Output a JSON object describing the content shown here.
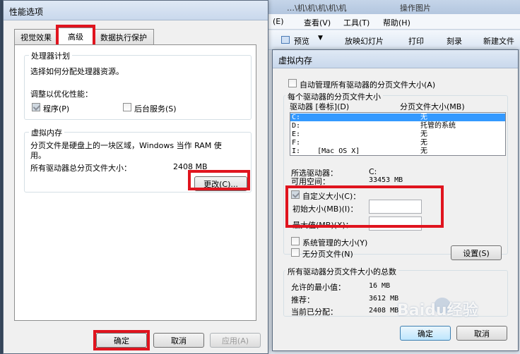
{
  "bg_window": {
    "menu": [
      "(E)",
      "查看(V)",
      "工具(T)",
      "帮助(H)"
    ],
    "breadcrumb_fragment": "…\\机\\机\\机\\机\\机",
    "breadcrumb_tail": "操作图片",
    "toolbar": [
      "预览",
      "放映幻灯片",
      "打印",
      "刻录",
      "新建文件"
    ]
  },
  "perf": {
    "title": "性能选项",
    "tabs": [
      "视觉效果",
      "高级",
      "数据执行保护"
    ],
    "processor": {
      "legend": "处理器计划",
      "desc": "选择如何分配处理器资源。",
      "adjust": "调整以优化性能：",
      "programs": "程序(P)",
      "services": "后台服务(S)"
    },
    "vm": {
      "legend": "虚拟内存",
      "desc1": "分页文件是硬盘上的一块区域，Windows 当作 RAM 使",
      "desc2": "用。",
      "total_label": "所有驱动器总分页文件大小：",
      "total_value": "2408 MB",
      "change_button": "更改(C)..."
    },
    "buttons": {
      "ok": "确定",
      "cancel": "取消",
      "apply": "应用(A)"
    }
  },
  "vmdlg": {
    "title": "虚拟内存",
    "auto_manage": "自动管理所有驱动器的分页文件大小(A)",
    "group_label": "每个驱动器的分页文件大小",
    "col_drive": "驱动器 [卷标](D)",
    "col_size": "分页文件大小(MB)",
    "drives": [
      {
        "drive": "C:",
        "size": "无"
      },
      {
        "drive": "D:",
        "size": "托管的系统"
      },
      {
        "drive": "E:",
        "size": "无"
      },
      {
        "drive": "F:",
        "size": "无"
      },
      {
        "drive": "I:    [Mac OS X]",
        "size": "无"
      }
    ],
    "selected_label": "所选驱动器：",
    "selected_value": "C:",
    "free_label": "可用空间：",
    "free_value": "33453 MB",
    "custom_size": "自定义大小(C)：",
    "initial_size": "初始大小(MB)(I)：",
    "max_size": "最大值(MB)(X)：",
    "system_managed": "系统管理的大小(Y)",
    "no_paging": "无分页文件(N)",
    "set_button": "设置(S)",
    "total_group": "所有驱动器分页文件大小的总数",
    "min_label": "允许的最小值：",
    "min_value": "16 MB",
    "rec_label": "推荐：",
    "rec_value": "3612 MB",
    "cur_label": "当前已分配：",
    "cur_value": "2408 MB",
    "ok": "确定",
    "cancel": "取消"
  },
  "watermark": "Baidu经验"
}
